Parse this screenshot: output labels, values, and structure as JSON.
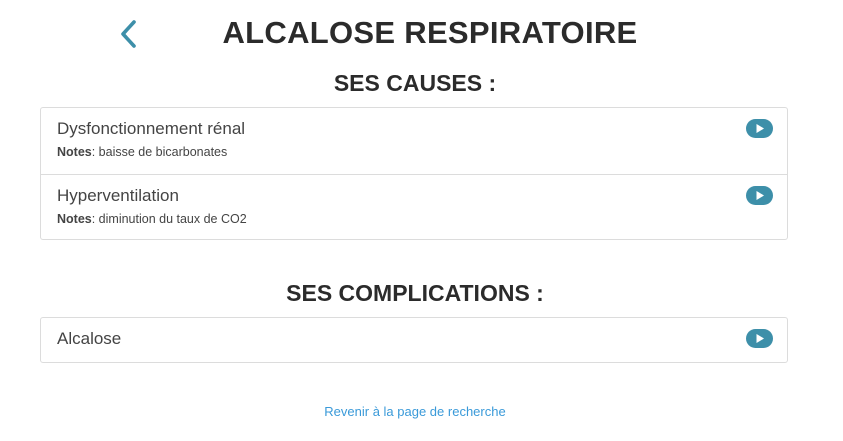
{
  "header": {
    "title": "ALCALOSE RESPIRATOIRE",
    "back_icon": "chevron-left-icon"
  },
  "causes": {
    "title": "SES CAUSES :",
    "items": [
      {
        "label": "Dysfonctionnement rénal",
        "notes_label": "Notes",
        "notes": ": baisse de bicarbonates"
      },
      {
        "label": "Hyperventilation",
        "notes_label": "Notes",
        "notes": ": diminution du taux de CO2"
      }
    ]
  },
  "complications": {
    "title": "SES COMPLICATIONS :",
    "items": [
      {
        "label": "Alcalose"
      }
    ]
  },
  "footer": {
    "link": "Revenir à la page de recherche"
  },
  "colors": {
    "accent": "#3d8fa9",
    "link": "#3a9ad9",
    "title": "#2b2b2b",
    "border": "#dcdcdc"
  },
  "icons": {
    "row_action": "play-circle-icon"
  }
}
